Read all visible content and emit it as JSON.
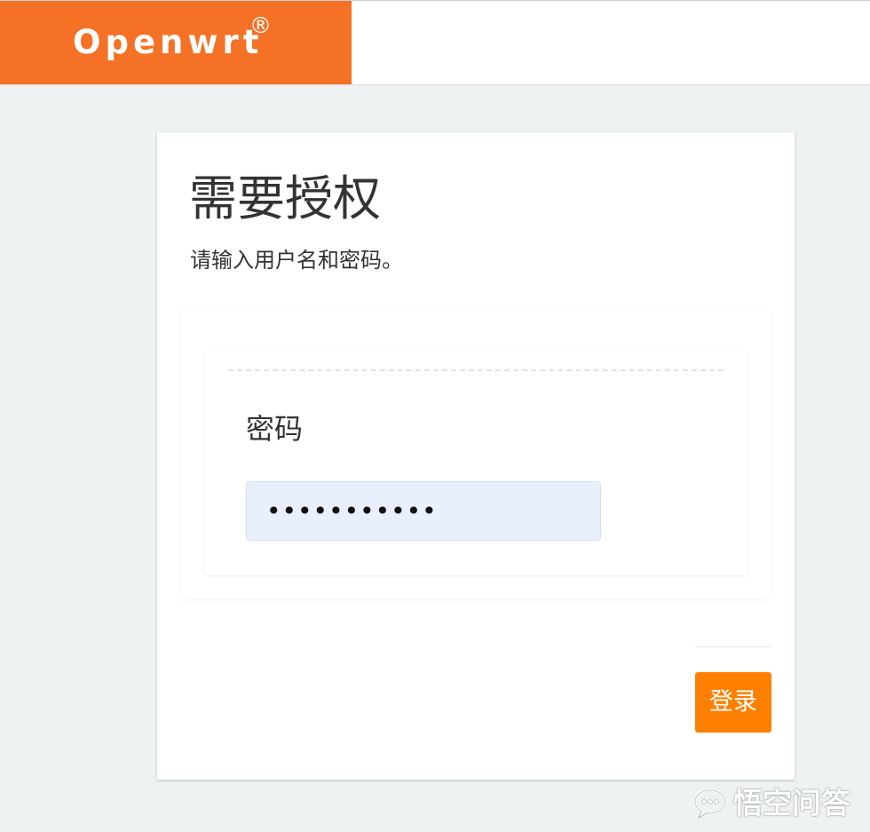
{
  "header": {
    "brand_name": "Openwrt",
    "brand_mark": "®",
    "brand_color": "#f47126"
  },
  "auth": {
    "title": "需要授权",
    "subtitle": "请输入用户名和密码。",
    "password_label": "密码",
    "password_value": "•••••••••••",
    "login_label": "登录",
    "button_color": "#ff8000"
  },
  "watermark": {
    "text": "悟空问答",
    "icon": "chat-bubble-logo-icon"
  }
}
